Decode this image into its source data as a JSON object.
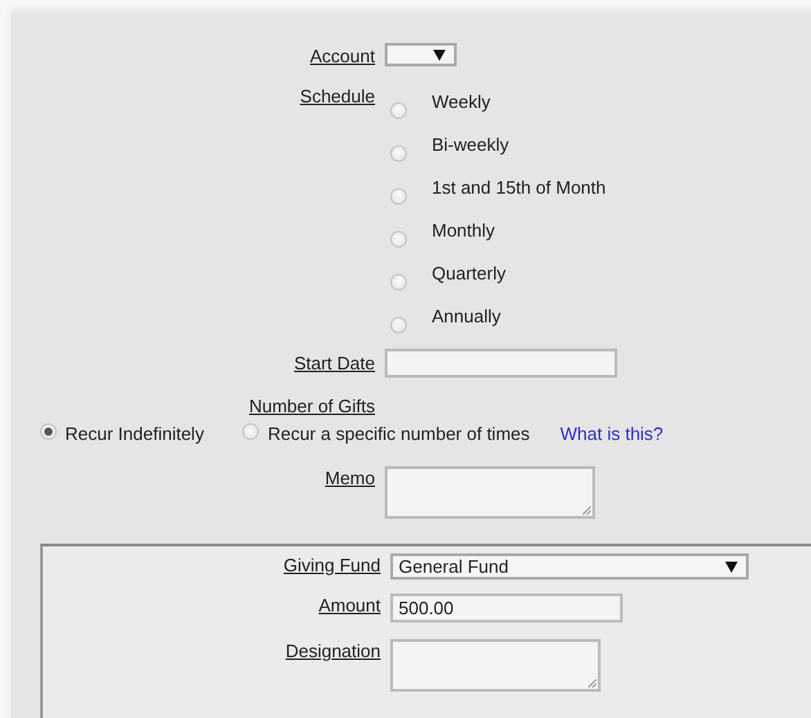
{
  "account": {
    "label": "Account"
  },
  "schedule": {
    "label": "Schedule",
    "options": [
      {
        "label": "Weekly",
        "selected": false
      },
      {
        "label": "Bi-weekly",
        "selected": false
      },
      {
        "label": "1st and 15th of Month",
        "selected": false
      },
      {
        "label": "Monthly",
        "selected": false
      },
      {
        "label": "Quarterly",
        "selected": false
      },
      {
        "label": "Annually",
        "selected": false
      }
    ]
  },
  "start_date": {
    "label": "Start Date"
  },
  "number_of_gifts": {
    "label": "Number of Gifts",
    "options": [
      {
        "label": "Recur Indefinitely",
        "selected": true
      },
      {
        "label": "Recur a specific number of times",
        "selected": false
      }
    ],
    "help_link": "What is this?"
  },
  "memo": {
    "label": "Memo"
  },
  "fund": {
    "giving_fund": {
      "label": "Giving Fund",
      "value": "General Fund"
    },
    "amount": {
      "label": "Amount",
      "value": "500.00"
    },
    "designation": {
      "label": "Designation"
    }
  }
}
